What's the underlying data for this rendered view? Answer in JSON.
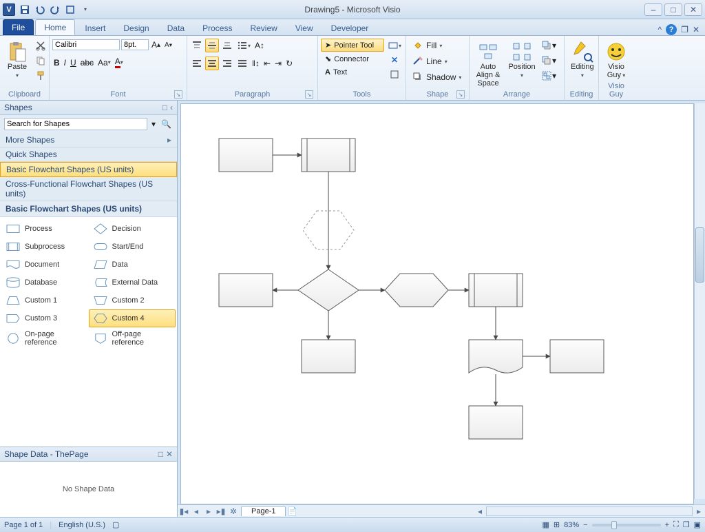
{
  "window": {
    "title": "Drawing5  -  Microsoft Visio"
  },
  "tabs": {
    "file": "File",
    "list": [
      "Home",
      "Insert",
      "Design",
      "Data",
      "Process",
      "Review",
      "View",
      "Developer"
    ],
    "active": 0
  },
  "ribbon": {
    "clipboard": {
      "paste": "Paste",
      "label": "Clipboard"
    },
    "font": {
      "name": "Calibri",
      "size": "8pt.",
      "label": "Font"
    },
    "paragraph": {
      "label": "Paragraph"
    },
    "tools": {
      "pointer": "Pointer Tool",
      "connector": "Connector",
      "text": "Text",
      "label": "Tools"
    },
    "shape": {
      "fill": "Fill",
      "line": "Line",
      "shadow": "Shadow",
      "label": "Shape"
    },
    "arrange": {
      "autoalign": "Auto Align & Space",
      "position": "Position",
      "label": "Arrange"
    },
    "editing": {
      "label": "Editing",
      "btn": "Editing"
    },
    "visioguy": {
      "label": "Visio Guy",
      "btn": "Visio Guy"
    }
  },
  "shapesPane": {
    "title": "Shapes",
    "searchPlaceholder": "Search for Shapes",
    "moreShapes": "More Shapes",
    "quickShapes": "Quick Shapes",
    "cat_basic": "Basic Flowchart Shapes (US units)",
    "cat_cross": "Cross-Functional Flowchart Shapes (US units)",
    "listTitle": "Basic Flowchart Shapes (US units)",
    "items": [
      {
        "l": "Process",
        "r": "Decision"
      },
      {
        "l": "Subprocess",
        "r": "Start/End"
      },
      {
        "l": "Document",
        "r": "Data"
      },
      {
        "l": "Database",
        "r": "External Data"
      },
      {
        "l": "Custom 1",
        "r": "Custom 2"
      },
      {
        "l": "Custom 3",
        "r": "Custom 4"
      },
      {
        "l": "On-page reference",
        "r": "Off-page reference"
      }
    ]
  },
  "shapeData": {
    "title": "Shape Data - ThePage",
    "body": "No Shape Data"
  },
  "page": {
    "tab": "Page-1"
  },
  "status": {
    "page": "Page 1 of 1",
    "lang": "English (U.S.)",
    "zoom": "83%"
  }
}
